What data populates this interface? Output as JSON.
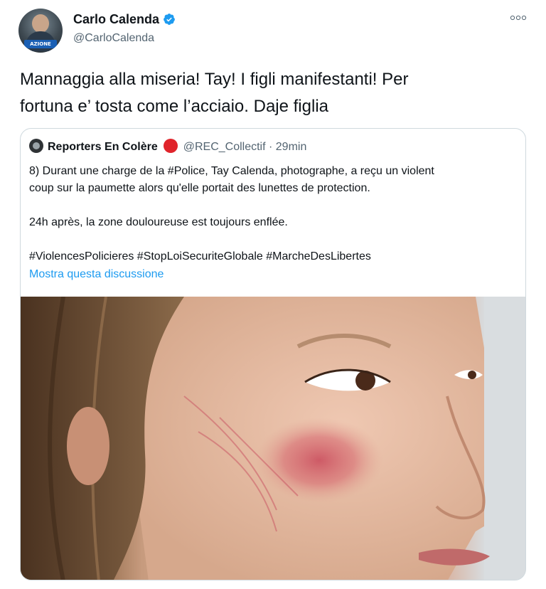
{
  "author": {
    "name": "Carlo Calenda",
    "handle": "@CarloCalenda",
    "avatar_badge": "AZIONE"
  },
  "tweet": {
    "text_line1": "Mannaggia alla miseria! Tay! I figli manifestanti! Per",
    "text_line2": "fortuna e’ tosta come l’acciaio. Daje figlia"
  },
  "more_icon": "more-dots-icon",
  "quoted": {
    "name": "Reporters En Colère",
    "handle": "@REC_Collectif",
    "time": "· 29min",
    "text_p1_line1": "8) Durant une charge de la #Police, Tay Calenda, photographe, a reçu un violent",
    "text_p1_line2": "coup sur la paumette alors qu'elle portait des lunettes de protection.",
    "text_p2": "24h après, la zone douloureuse est toujours enflée.",
    "text_p3": "#ViolencesPolicieres #StopLoiSecuriteGlobale #MarcheDesLibertes",
    "show_thread": "Mostra questa discussione"
  },
  "colors": {
    "accent": "#1d9bf0",
    "text_primary": "#0f1419",
    "text_secondary": "#536471",
    "border": "#cfd9de",
    "red_circle": "#e0242b"
  }
}
